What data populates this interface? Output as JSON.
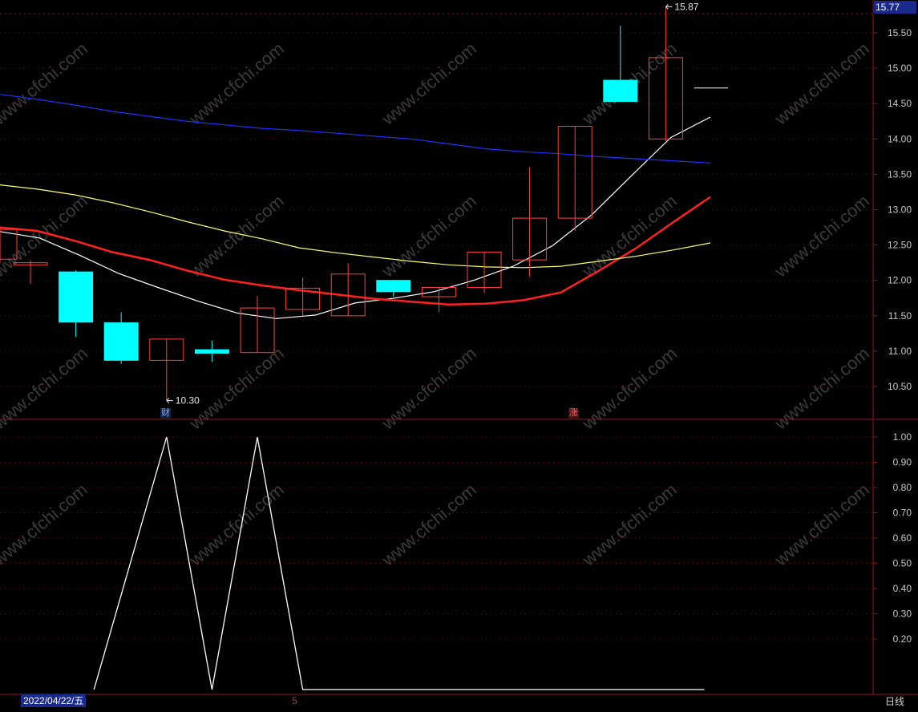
{
  "chart_data": [
    {
      "type": "candlestick",
      "name": "price",
      "y_axis_ticks": [
        "15.50",
        "15.00",
        "14.50",
        "14.00",
        "13.50",
        "13.00",
        "12.50",
        "12.00",
        "11.50",
        "11.00",
        "10.50"
      ],
      "ylim": [
        10.08,
        15.95
      ],
      "candles": [
        {
          "o": 12.3,
          "h": 12.75,
          "l": 12.25,
          "c": 12.72
        },
        {
          "o": 12.22,
          "h": 12.28,
          "l": 11.95,
          "c": 12.25
        },
        {
          "o": 12.12,
          "h": 12.14,
          "l": 11.2,
          "c": 11.41
        },
        {
          "o": 11.4,
          "h": 11.55,
          "l": 10.82,
          "c": 10.87
        },
        {
          "o": 10.87,
          "h": 11.17,
          "l": 10.3,
          "c": 11.17
        },
        {
          "o": 11.02,
          "h": 11.15,
          "l": 10.85,
          "c": 10.97
        },
        {
          "o": 10.98,
          "h": 11.78,
          "l": 10.98,
          "c": 11.61
        },
        {
          "o": 11.59,
          "h": 12.04,
          "l": 11.5,
          "c": 11.89
        },
        {
          "o": 11.5,
          "h": 12.24,
          "l": 11.5,
          "c": 12.09
        },
        {
          "o": 12.0,
          "h": 12.0,
          "l": 11.77,
          "c": 11.84
        },
        {
          "o": 11.77,
          "h": 11.9,
          "l": 11.55,
          "c": 11.9
        },
        {
          "o": 11.9,
          "h": 12.4,
          "l": 11.82,
          "c": 12.4
        },
        {
          "o": 12.29,
          "h": 13.6,
          "l": 12.05,
          "c": 12.88
        },
        {
          "o": 12.88,
          "h": 14.18,
          "l": 12.7,
          "c": 14.18
        },
        {
          "o": 14.83,
          "h": 15.6,
          "l": 14.53,
          "c": 14.53
        },
        {
          "o": 14.0,
          "h": 15.87,
          "l": 13.97,
          "c": 15.15
        }
      ],
      "current_price_line": 14.72,
      "current_price": "15.77",
      "annotations": [
        {
          "label": "15.87",
          "value": 15.87,
          "candle": 15
        },
        {
          "label": "10.30",
          "value": 10.3,
          "candle": 4
        }
      ],
      "moving_averages": [
        {
          "color": "#ffffff",
          "values": [
            12.69,
            12.6,
            12.36,
            12.1,
            11.9,
            11.71,
            11.54,
            11.46,
            11.51,
            11.68,
            11.75,
            11.84,
            12.0,
            12.2,
            12.49,
            12.93,
            13.48,
            14.02,
            14.31
          ]
        },
        {
          "color": "#ff2020",
          "values": [
            12.75,
            12.7,
            12.56,
            12.4,
            12.29,
            12.14,
            12.01,
            11.93,
            11.86,
            11.8,
            11.74,
            11.7,
            11.66,
            11.67,
            11.72,
            11.83,
            12.13,
            12.45,
            12.82,
            13.18
          ]
        },
        {
          "color": "#ffff66",
          "values": [
            13.35,
            13.29,
            13.21,
            13.1,
            12.97,
            12.83,
            12.7,
            12.59,
            12.46,
            12.39,
            12.33,
            12.27,
            12.22,
            12.19,
            12.18,
            12.2,
            12.27,
            12.34,
            12.43,
            12.53
          ]
        },
        {
          "color": "#2030ff",
          "values": [
            14.63,
            14.56,
            14.48,
            14.39,
            14.32,
            14.25,
            14.2,
            14.15,
            14.12,
            14.08,
            14.04,
            14.0,
            13.93,
            13.86,
            13.82,
            13.79,
            13.75,
            13.72,
            13.69,
            13.66
          ]
        }
      ]
    },
    {
      "type": "line",
      "name": "indicator",
      "y_axis_ticks": [
        "1.00",
        "0.90",
        "0.80",
        "0.70",
        "0.60",
        "0.50",
        "0.40",
        "0.30",
        "0.20"
      ],
      "ylim": [
        -0.05,
        1.0
      ],
      "color": "#ffffff",
      "x": [
        2.4,
        4.0,
        5.0,
        6.0,
        7.0,
        15.85
      ],
      "values": [
        0,
        1,
        0,
        1,
        0,
        0
      ]
    }
  ],
  "footer": {
    "date": "2022/04/22/五",
    "marker_five": "5",
    "period": "日线"
  },
  "markers": {
    "cai": "财",
    "zhang": "涨"
  },
  "watermark": "www.cfchi.com",
  "colors": {
    "up": "#ff4040",
    "down": "#00ffff",
    "grid": "#8b1a1a",
    "axis": "#c8c8c8"
  }
}
